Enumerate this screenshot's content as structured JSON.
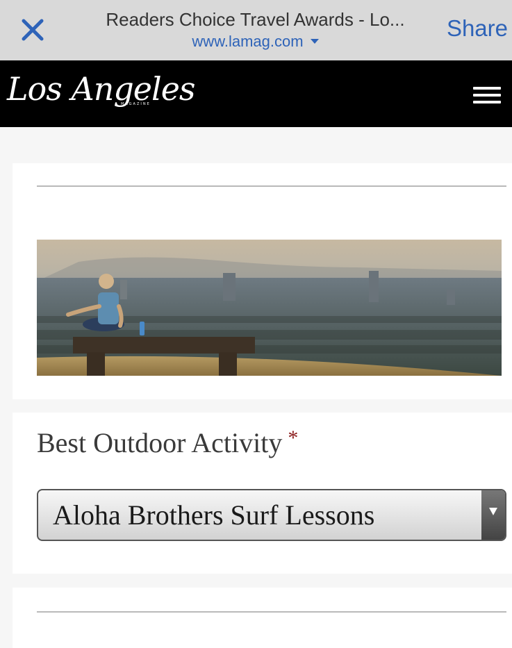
{
  "browser": {
    "title": "Readers Choice Travel Awards - Lo...",
    "url": "www.lamag.com",
    "share_label": "Share"
  },
  "site": {
    "logo_text": "Los Angeles",
    "logo_subtext": "MAGAZINE"
  },
  "form": {
    "question_label": "Best Outdoor Activity",
    "required_marker": "*",
    "selected_value": "Aloha Brothers Surf Lessons"
  },
  "colors": {
    "browser_bar": "#d9d9d9",
    "link_blue": "#2e63b8",
    "header_black": "#000000",
    "required_red": "#8b1c1c"
  },
  "icons": {
    "close": "close-icon",
    "url_dropdown": "chevron-down-icon",
    "menu": "hamburger-menu-icon",
    "select_dropdown": "dropdown-arrow-icon"
  }
}
